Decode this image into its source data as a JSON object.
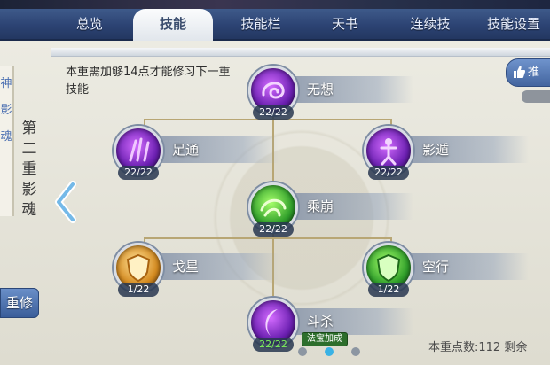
{
  "tabs": [
    {
      "label": "总览",
      "active": false
    },
    {
      "label": "技能",
      "active": true
    },
    {
      "label": "技能栏",
      "active": false
    },
    {
      "label": "天书",
      "active": false
    },
    {
      "label": "连续技",
      "active": false
    },
    {
      "label": "技能设置",
      "active": false
    }
  ],
  "left": {
    "scroll_text": "神 影 魂",
    "vertical_title": "第二重影魂",
    "repair_label": "重修"
  },
  "hint_text": "本重需加够14点才能修习下一重技能",
  "skills": [
    {
      "name": "无想",
      "count": "22/22",
      "color": "purple",
      "icon": "swirl-icon"
    },
    {
      "name": "足通",
      "count": "22/22",
      "color": "purple",
      "icon": "claw-icon"
    },
    {
      "name": "影遁",
      "count": "22/22",
      "color": "purple",
      "icon": "figure-icon"
    },
    {
      "name": "乘崩",
      "count": "22/22",
      "color": "green",
      "icon": "vortex-icon"
    },
    {
      "name": "戈星",
      "count": "1/22",
      "color": "gold",
      "icon": "shield-icon"
    },
    {
      "name": "空行",
      "count": "1/22",
      "color": "green",
      "icon": "shield-icon"
    },
    {
      "name": "斗杀",
      "count": "22/22",
      "color": "purple",
      "icon": "crescent-icon"
    }
  ],
  "tag_label": "法宝加成",
  "recommend_label": "推",
  "points_text": "本重点数:112   剩余",
  "page_dots": {
    "count": 3,
    "active": 1
  },
  "colors": {
    "tab_bar": "#2c4373",
    "panel": "#e6e4d8",
    "active_dot": "#39b2e5",
    "count_green": "#7df05a"
  }
}
